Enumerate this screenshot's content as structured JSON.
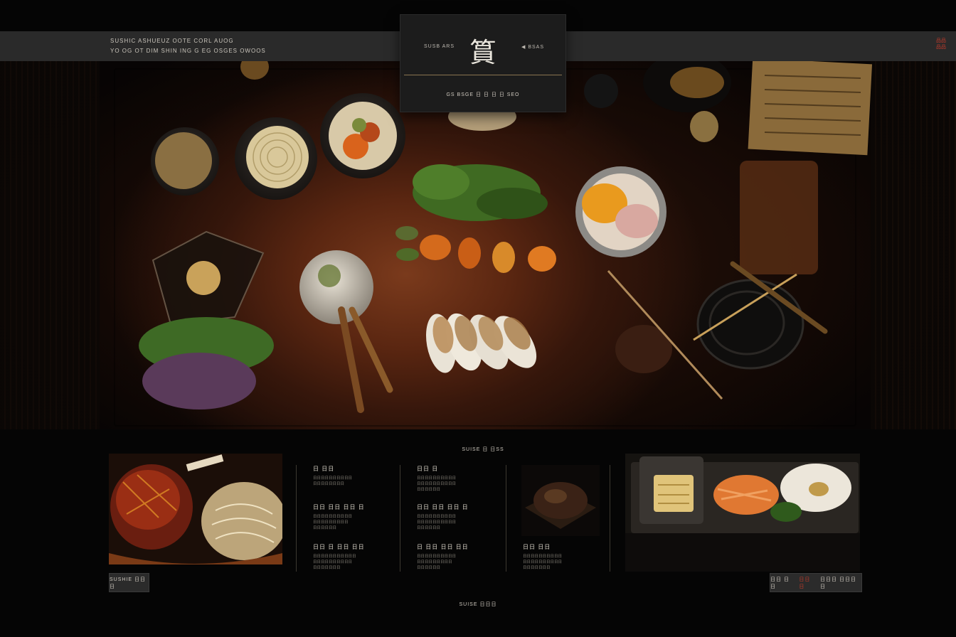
{
  "header": {
    "tagline_1": "SUSHIC ASHUEUZ OOTE CORL AUOG",
    "tagline_2": "YO OG OT DIM SHIN ING G EG OSGES OWOOS",
    "lang_line_1": "品品",
    "lang_line_2": "品品"
  },
  "logo": {
    "mark": "篔",
    "left_label": "SUSB ARS",
    "right_label": "◀ BSAS",
    "subtitle": "GS BSGE 日 日 日 日 SEO"
  },
  "section": {
    "label": "SUISE 日 日SS"
  },
  "menu": [
    {
      "items": [
        {
          "title": "日 日日",
          "desc": [
            "日日日日日日日日日日",
            "日日日日日日日日"
          ]
        },
        {
          "title": "日日 日日 日日 日",
          "desc": [
            "日日日日日日日日日日",
            "日日日日日日日日日",
            "日日日日日日"
          ]
        },
        {
          "title": "日日 日 日日 日日",
          "desc": [
            "日日日日日日日日日日日",
            "日日日日日日日日日日",
            "日日日日日日日"
          ]
        }
      ]
    },
    {
      "items": [
        {
          "title": "日日 日",
          "desc": [
            "日日日日日日日日日日",
            "日日日日日日日日日日",
            "日日日日日日"
          ]
        },
        {
          "title": "日日 日日 日日 日",
          "desc": [
            "日日日日日日日日日日",
            "日日日日日日日日日日",
            "日日日日日日"
          ]
        },
        {
          "title": "日 日日 日日 日日",
          "desc": [
            "日日日日日日日日日日",
            "日日日日日日日日日",
            "日日日日日日"
          ]
        }
      ]
    },
    {
      "items": [
        {
          "title": "日日 日日",
          "desc": [
            "日日日日日日日日日日",
            "日日日日日日日日日日",
            "日日日日日日日"
          ]
        }
      ]
    }
  ],
  "buttons": {
    "left": "SUSHIE 日日日",
    "right_a": "日日 日日",
    "right_accent": "日日日",
    "right_b": "日日日 日日日日"
  },
  "footer": {
    "label": "SUISE 日日日"
  },
  "colors": {
    "accent": "#c23a2a",
    "gold_rule": "#8a7550",
    "bar": "#2a2a2a"
  }
}
